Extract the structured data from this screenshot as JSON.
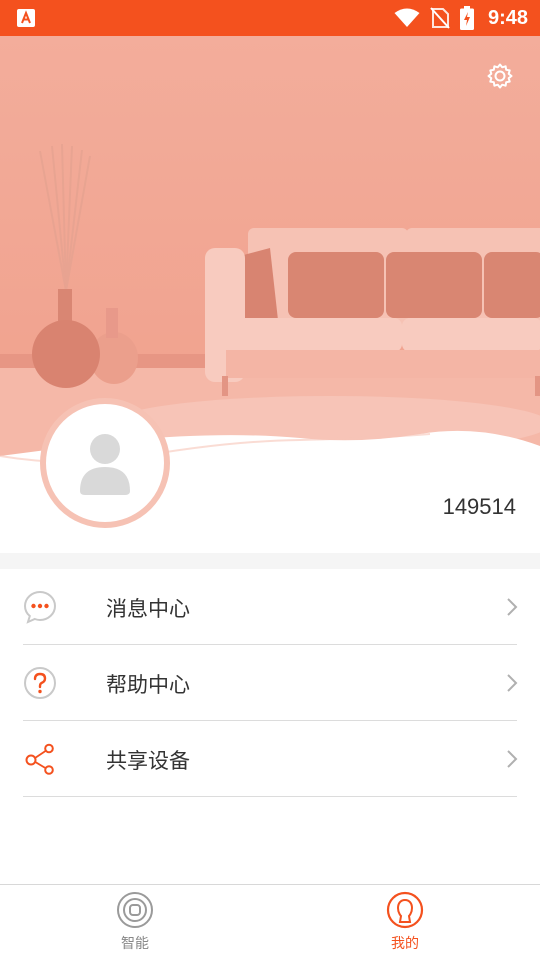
{
  "status_bar": {
    "time": "9:48",
    "bg_color": "#f4511e"
  },
  "profile": {
    "username": "149514",
    "banner_color": "#f2a896",
    "settings_icon": "gear-icon",
    "avatar_icon": "avatar-placeholder-icon"
  },
  "menu": {
    "items": [
      {
        "label": "消息中心",
        "icon": "message-icon"
      },
      {
        "label": "帮助中心",
        "icon": "help-icon"
      },
      {
        "label": "共享设备",
        "icon": "share-icon"
      }
    ]
  },
  "bottom_nav": {
    "items": [
      {
        "label": "智能",
        "icon": "smart-icon",
        "active": false
      },
      {
        "label": "我的",
        "icon": "profile-icon",
        "active": true
      }
    ],
    "accent": "#f4511e",
    "inactive_color": "#888888"
  }
}
